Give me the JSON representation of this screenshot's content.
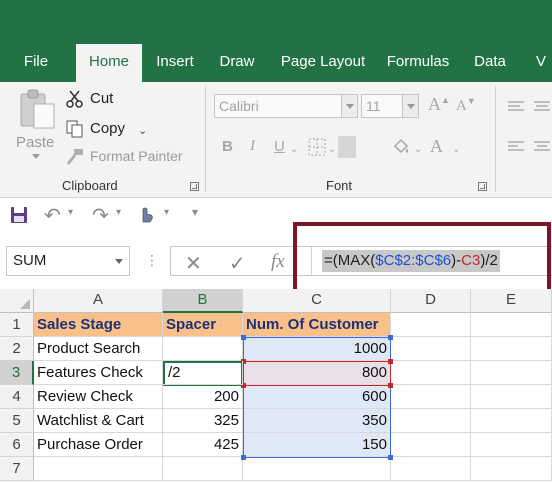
{
  "tabs": [
    {
      "id": "file",
      "label": "File",
      "active": false
    },
    {
      "id": "home",
      "label": "Home",
      "active": true
    },
    {
      "id": "insert",
      "label": "Insert",
      "active": false
    },
    {
      "id": "draw",
      "label": "Draw",
      "active": false
    },
    {
      "id": "page-layout",
      "label": "Page Layout",
      "active": false
    },
    {
      "id": "formulas",
      "label": "Formulas",
      "active": false
    },
    {
      "id": "data",
      "label": "Data",
      "active": false
    },
    {
      "id": "view",
      "label": "V",
      "active": false
    }
  ],
  "clipboard": {
    "paste_label": "Paste",
    "cut_label": "Cut",
    "copy_label": "Copy",
    "format_painter_label": "Format Painter",
    "group_label": "Clipboard"
  },
  "font": {
    "font_name": "Calibri",
    "font_size": "11",
    "bold_label": "B",
    "italic_label": "I",
    "underline_label": "U",
    "group_label": "Font"
  },
  "formula_bar": {
    "name_box": "SUM",
    "cancel_glyph": "✕",
    "enter_glyph": "✓",
    "fx_label": "fx",
    "formula_parts": {
      "p1": "=(MAX(",
      "p2": "$C$2:$C$6",
      "p3": ")-",
      "p4": "C3",
      "p5": ")/2"
    }
  },
  "columns": [
    "A",
    "B",
    "C",
    "D",
    "E"
  ],
  "rows": [
    "1",
    "2",
    "3",
    "4",
    "5",
    "6",
    "7"
  ],
  "table": {
    "headers": [
      "Sales Stage",
      "Spacer",
      "Num. Of Customer"
    ],
    "stages": [
      "Product Search",
      "Features Check",
      "Review Check",
      "Watchlist & Cart",
      "Purchase Order"
    ],
    "spacer": [
      "",
      "/2",
      "200",
      "325",
      "425"
    ],
    "customers": [
      "1000",
      "800",
      "600",
      "350",
      "150"
    ]
  },
  "colors": {
    "brand": "#217346",
    "header_fill": "#f9c089",
    "header_text": "#1e3276",
    "range_blue": "#3b6bd6",
    "range_red": "#c62828",
    "callout_border": "#7d1428"
  }
}
